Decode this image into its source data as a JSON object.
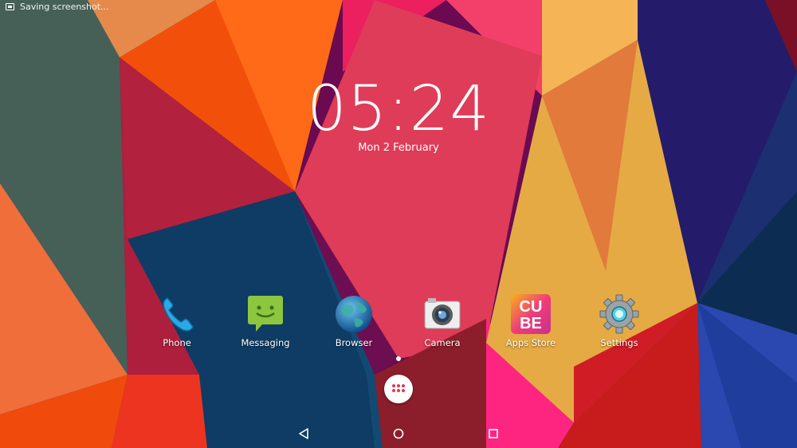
{
  "status_bar": {
    "notification_text": "Saving screenshot..."
  },
  "clock": {
    "time": "05:24",
    "date": "Mon 2 February"
  },
  "apps": [
    {
      "label": "Phone",
      "icon": "phone-icon"
    },
    {
      "label": "Messaging",
      "icon": "messaging-icon"
    },
    {
      "label": "Browser",
      "icon": "browser-icon"
    },
    {
      "label": "Camera",
      "icon": "camera-icon"
    },
    {
      "label": "Apps Store",
      "icon": "cube-apps-store-icon",
      "logo_text": [
        "CU",
        "BE"
      ]
    },
    {
      "label": "Settings",
      "icon": "settings-gear-icon"
    }
  ],
  "navigation": {
    "back": "back-icon",
    "home": "home-icon",
    "recents": "recents-icon"
  },
  "colors": {
    "accent_drawer": "#e8344e",
    "wallpaper_base": "#0f3c64"
  }
}
